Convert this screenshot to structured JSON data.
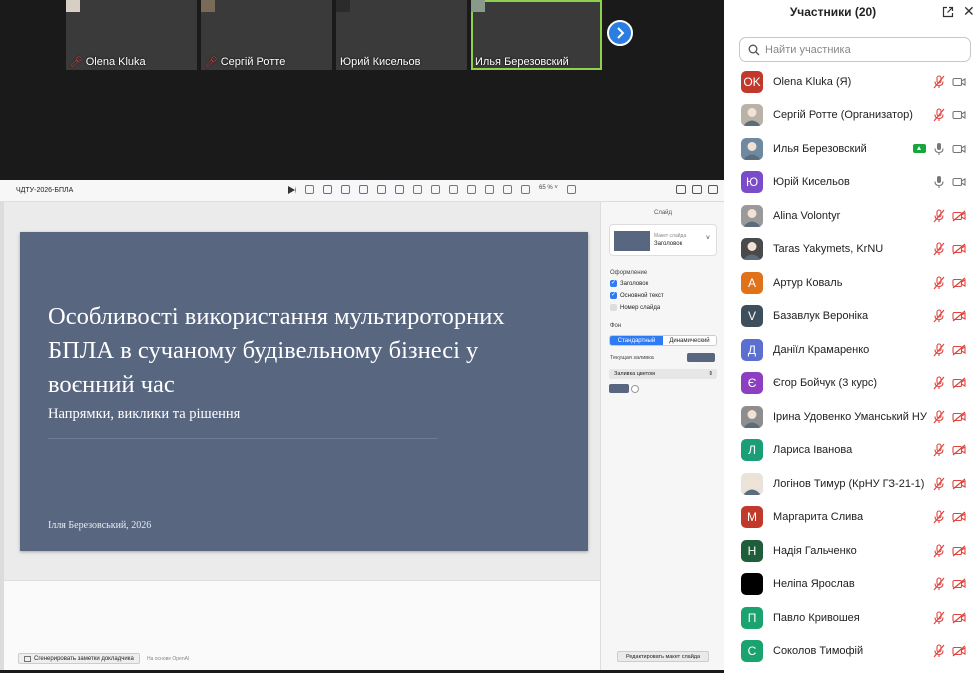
{
  "thumbnails": [
    {
      "name": "Olena Kluka",
      "muted": true,
      "width": 131,
      "bg": "#d8cfc4"
    },
    {
      "name": "Сергій Ротте",
      "muted": true,
      "width": 131,
      "bg": "#7a6a58"
    },
    {
      "name": "Юрий Кисельов",
      "muted": false,
      "width": 131,
      "bg": "#2b2b2b"
    },
    {
      "name": "Илья Березовский",
      "muted": false,
      "width": 131,
      "bg": "#8a9a8a",
      "active": true
    }
  ],
  "presentation": {
    "doc_title": "ЧДТУ-2026-БПЛА",
    "zoom": "65 % ˅",
    "slide": {
      "title": "Особливості використання мультироторних БПЛА в сучаному будівельному бізнесі у воєнний час",
      "subtitle": "Напрямки, виклики та рішення",
      "author": "Ілля Березовський, 2026",
      "bg_color": "#586680"
    },
    "inspector": {
      "header": "Слайд",
      "layout_label": "Макет слайда",
      "layout_value": "Заголовок",
      "design_label": "Оформление",
      "checkboxes": [
        {
          "label": "Заголовок",
          "checked": true
        },
        {
          "label": "Основной текст",
          "checked": true
        },
        {
          "label": "Номер слайда",
          "checked": false
        }
      ],
      "bg_label": "Фон",
      "seg_standard": "Стандартный",
      "seg_dynamic": "Динамический",
      "fill_label": "Текущая заливка",
      "fill_select": "Заливка цветом",
      "edit_layout": "Редактировать макет слайда"
    },
    "notes_button": "Сгенерировать заметки докладчика",
    "notes_hint": "На основе OpenAI"
  },
  "panel": {
    "title": "Участники (20)",
    "search_placeholder": "Найти участника",
    "participants": [
      {
        "name": "Olena Kluka (Я)",
        "initials": "OK",
        "color": "#c0392b",
        "mic": "off",
        "cam": "on"
      },
      {
        "name": "Сергій Ротте (Организатор)",
        "initials": "",
        "color": "#b9b2a6",
        "photo": true,
        "mic": "off",
        "cam": "on"
      },
      {
        "name": "Илья Березовский",
        "initials": "",
        "color": "#6f8aa0",
        "photo": true,
        "mic": "on",
        "cam": "on",
        "sharing": true
      },
      {
        "name": "Юрій Кисельов",
        "initials": "Ю",
        "color": "#7b4cc9",
        "mic": "on",
        "cam": "on"
      },
      {
        "name": "Alina Volontyr",
        "initials": "",
        "color": "#9a9a9a",
        "photo": true,
        "mic": "off",
        "cam": "off"
      },
      {
        "name": "Taras Yakymets, KrNU",
        "initials": "",
        "color": "#4a4a4a",
        "photo": true,
        "mic": "off",
        "cam": "off"
      },
      {
        "name": "Артур Коваль",
        "initials": "А",
        "color": "#e0731a",
        "mic": "off",
        "cam": "off"
      },
      {
        "name": "Базавлук Вероніка",
        "initials": "V",
        "color": "#3d4f5c",
        "mic": "off",
        "cam": "off"
      },
      {
        "name": "Даніїл Крамаренко",
        "initials": "Д",
        "color": "#5b6fd1",
        "mic": "off",
        "cam": "off"
      },
      {
        "name": "Єгор Бойчук (3 курс)",
        "initials": "Є",
        "color": "#8c3fc1",
        "mic": "off",
        "cam": "off"
      },
      {
        "name": "Ірина Удовенко Уманський НУ",
        "initials": "",
        "color": "#8e8e8e",
        "photo": true,
        "mic": "off",
        "cam": "off"
      },
      {
        "name": "Лариса Іванова",
        "initials": "Л",
        "color": "#1b9e77",
        "mic": "off",
        "cam": "off"
      },
      {
        "name": "Логінов Тимур (КрНУ ГЗ-21-1)",
        "initials": "",
        "color": "#e9e3da",
        "photo": true,
        "mic": "off",
        "cam": "off"
      },
      {
        "name": "Маргарита Слива",
        "initials": "М",
        "color": "#c0392b",
        "mic": "off",
        "cam": "off"
      },
      {
        "name": "Надія Гальченко",
        "initials": "Н",
        "color": "#1e5e3a",
        "mic": "off",
        "cam": "off"
      },
      {
        "name": "Неліпа Ярослав",
        "initials": "",
        "color": "#000000",
        "mic": "off",
        "cam": "off"
      },
      {
        "name": "Павло Кривошея",
        "initials": "П",
        "color": "#1aa36f",
        "mic": "off",
        "cam": "off"
      },
      {
        "name": "Соколов Тимофій",
        "initials": "С",
        "color": "#1aa36f",
        "mic": "off",
        "cam": "off"
      }
    ]
  }
}
